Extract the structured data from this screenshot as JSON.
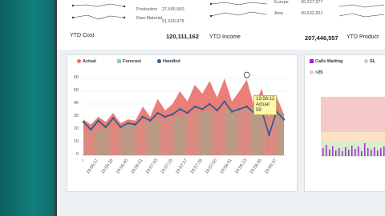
{
  "kpi_top": {
    "production_label": "Production",
    "production_value": "27,665,560",
    "raw_material_label": "Raw Material",
    "raw_material_value": "51,620,978",
    "europe_label": "Europe",
    "europe_value": "26,227,977",
    "asia_label": "Asia",
    "asia_value": "49,632,821",
    "ytd_cost_label": "YTD Cost",
    "ytd_cost_value": "120,111,162",
    "ytd_income_label": "YTD Income",
    "ytd_income_value": "207,446,557",
    "ytd_product_label": "YTD Product"
  },
  "main_chart": {
    "legend": [
      {
        "label": "Actual",
        "color": "#e8706a"
      },
      {
        "label": "Forecast",
        "color": "#9cc9b0"
      },
      {
        "label": "Handled",
        "color": "#2e5f8f"
      }
    ],
    "y_ticks": [
      "60",
      "50",
      "40",
      "30",
      "20",
      "10",
      "0"
    ],
    "tooltip_time": "19:58:12",
    "tooltip_series": "Actual",
    "tooltip_value": "59"
  },
  "side_chart": {
    "legend_calls_waiting": "Calls Waiting",
    "legend_sl": "SL",
    "legend_gt25": ">25"
  },
  "chart_data": {
    "type": "area",
    "ylim": [
      0,
      65
    ],
    "x": [
      "19:56:05",
      "19:56:11",
      "19:56:17",
      "19:56:22",
      "19:56:28",
      "19:56:34",
      "19:56:40",
      "19:56:46",
      "19:56:51",
      "19:56:57",
      "19:57:03",
      "19:57:09",
      "19:57:15",
      "19:57:21",
      "19:57:27",
      "19:57:32",
      "19:57:38",
      "19:57:44",
      "19:57:50",
      "19:57:56",
      "19:58:01",
      "19:58:07",
      "19:58:13",
      "19:58:19",
      "19:58:25",
      "19:58:31",
      "19:58:37",
      "19:58:43"
    ],
    "series": [
      {
        "name": "Actual",
        "values": [
          28,
          24,
          30,
          26,
          33,
          25,
          28,
          27,
          38,
          30,
          44,
          35,
          40,
          50,
          42,
          55,
          48,
          58,
          45,
          60,
          42,
          50,
          59,
          38,
          52,
          30,
          46,
          32
        ]
      },
      {
        "name": "Forecast",
        "values": [
          18,
          20,
          20,
          22,
          22,
          23,
          24,
          25,
          26,
          27,
          28,
          29,
          30,
          31,
          32,
          33,
          34,
          35,
          35,
          36,
          36,
          37,
          37,
          37,
          36,
          35,
          34,
          33
        ]
      },
      {
        "name": "Handled",
        "values": [
          26,
          20,
          27,
          22,
          29,
          22,
          25,
          24,
          30,
          27,
          33,
          30,
          32,
          36,
          33,
          38,
          36,
          40,
          35,
          42,
          34,
          36,
          38,
          33,
          35,
          16,
          34,
          28
        ]
      }
    ]
  }
}
